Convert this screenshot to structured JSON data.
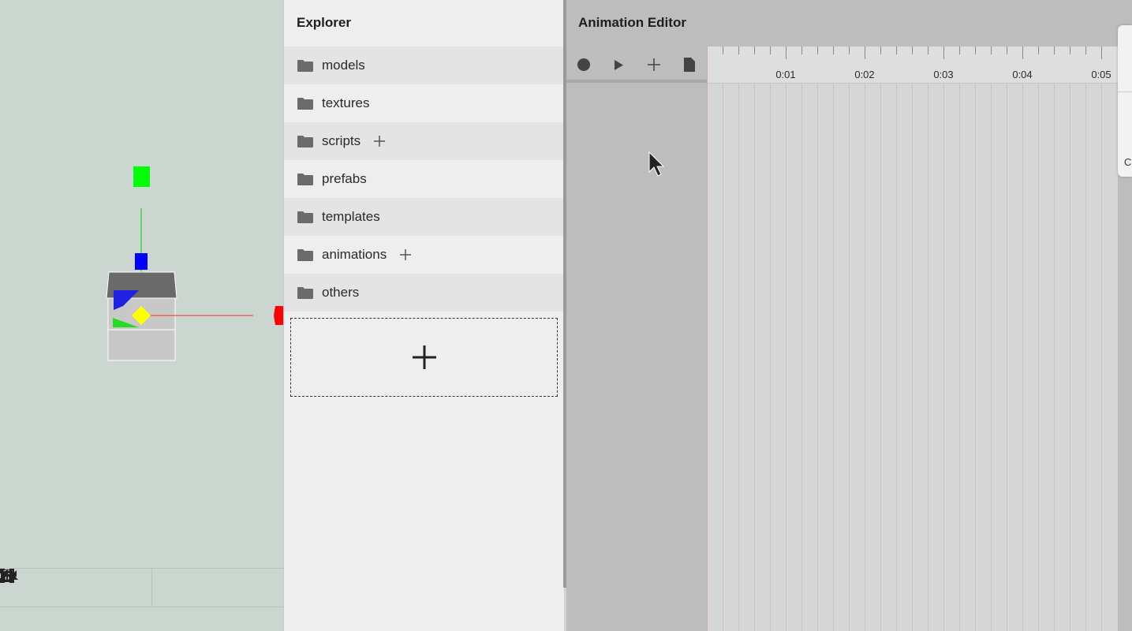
{
  "viewport": {
    "toolbar": [
      {
        "icon": "terrain-icon"
      },
      {
        "icon": "save-icon"
      },
      {
        "icon": "undo-icon"
      },
      {
        "icon": "redo-icon"
      },
      {
        "icon": "add-icon"
      },
      {
        "icon": "play-icon"
      },
      {
        "icon": "fullscreen-icon"
      }
    ]
  },
  "explorer": {
    "title": "Explorer",
    "folders": [
      {
        "label": "models"
      },
      {
        "label": "textures"
      },
      {
        "label": "scripts"
      },
      {
        "label": "prefabs"
      },
      {
        "label": "templates"
      },
      {
        "label": "animations"
      },
      {
        "label": "others"
      }
    ]
  },
  "animation_editor": {
    "title": "Animation Editor",
    "toolbar": [
      {
        "icon": "record-icon"
      },
      {
        "icon": "play-icon"
      },
      {
        "icon": "add-icon"
      },
      {
        "icon": "file-icon"
      }
    ],
    "time_labels": [
      "0:01",
      "0:02",
      "0:03",
      "0:04",
      "0:05"
    ]
  },
  "side_tab": {
    "label": "C"
  },
  "colors": {
    "viewport_bg": "#ccd6d1",
    "panel_bg": "#eeeeee",
    "timeline_bg": "#d6d6d6",
    "gizmo_x": "#ff0000",
    "gizmo_y": "#00ff00",
    "gizmo_z": "#0000ff",
    "gizmo_center": "#ffff00"
  }
}
